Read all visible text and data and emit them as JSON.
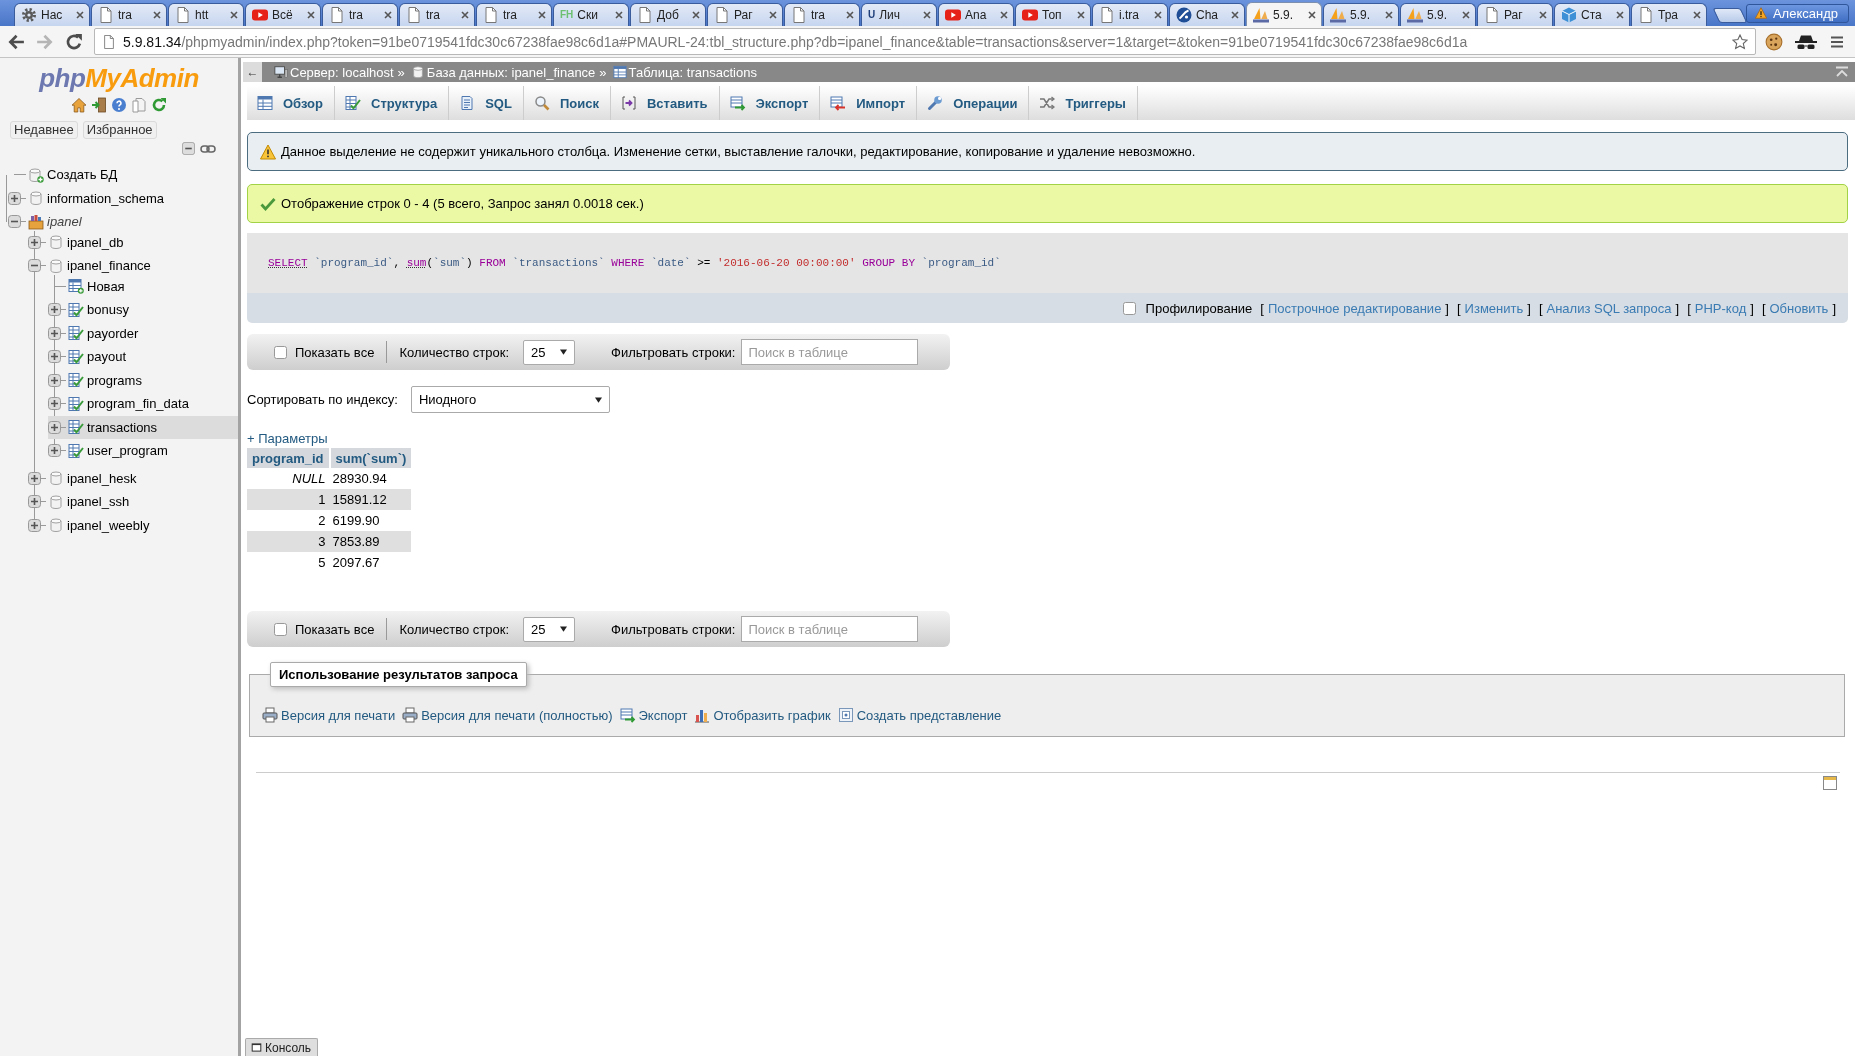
{
  "browser": {
    "tabs": [
      {
        "title": "Нас",
        "kind": "gear",
        "selected": false
      },
      {
        "title": "tra",
        "kind": "page",
        "selected": false
      },
      {
        "title": "htt",
        "kind": "page",
        "selected": false
      },
      {
        "title": "Всё",
        "kind": "video",
        "selected": false
      },
      {
        "title": "tra",
        "kind": "page",
        "selected": false
      },
      {
        "title": "tra",
        "kind": "page",
        "selected": false
      },
      {
        "title": "tra",
        "kind": "page",
        "selected": false
      },
      {
        "title": "Ски",
        "kind": "letters",
        "letters": "FH",
        "color": "#6cc070",
        "selected": false
      },
      {
        "title": "Доб",
        "kind": "page",
        "selected": false
      },
      {
        "title": "Раг",
        "kind": "page",
        "selected": false
      },
      {
        "title": "tra",
        "kind": "page",
        "selected": false
      },
      {
        "title": "Лич",
        "kind": "letters",
        "letters": "U",
        "color": "#1f3f7a",
        "selected": false
      },
      {
        "title": "Ana",
        "kind": "video",
        "selected": false
      },
      {
        "title": "Топ",
        "kind": "video",
        "selected": false
      },
      {
        "title": "i.tra",
        "kind": "page",
        "selected": false
      },
      {
        "title": "Cha",
        "kind": "circle-logo",
        "selected": false
      },
      {
        "title": "5.9.",
        "kind": "sail",
        "selected": true
      },
      {
        "title": "5.9.",
        "kind": "sail",
        "selected": false
      },
      {
        "title": "5.9.",
        "kind": "sail",
        "selected": false
      },
      {
        "title": "Раг",
        "kind": "page",
        "selected": false
      },
      {
        "title": "Ста",
        "kind": "cube",
        "selected": false
      },
      {
        "title": "Тра",
        "kind": "page",
        "selected": false
      }
    ],
    "profile": "Александр",
    "address": {
      "host": "5.9.81.34",
      "path": "/phpmyadmin/index.php?token=91be0719541fdc30c67238fae98c6d1a#PMAURL-24:tbl_structure.php?db=ipanel_finance&table=transactions&server=1&target=&token=91be0719541fdc30c67238fae98c6d1a"
    }
  },
  "sidebar": {
    "logo": {
      "prefix": "php",
      "name": "MyAdmin"
    },
    "buttons": [
      "Недавнее",
      "Избранное"
    ],
    "tree": [
      {
        "label": "Создать БД",
        "kind": "new-database",
        "selected": false
      },
      {
        "label": "information_schema",
        "kind": "database",
        "expanded": false,
        "selected": false
      },
      {
        "label": "ipanel",
        "kind": "group",
        "expanded": true,
        "selected": false,
        "children": [
          {
            "label": "ipanel_db",
            "kind": "database",
            "expanded": false,
            "selected": false
          },
          {
            "label": "ipanel_finance",
            "kind": "database",
            "expanded": true,
            "selected": false,
            "children": [
              {
                "label": "Новая",
                "kind": "new-table",
                "selected": false
              },
              {
                "label": "bonusy",
                "kind": "table",
                "expanded": false,
                "selected": false
              },
              {
                "label": "payorder",
                "kind": "table",
                "expanded": false,
                "selected": false
              },
              {
                "label": "payout",
                "kind": "table",
                "expanded": false,
                "selected": false
              },
              {
                "label": "programs",
                "kind": "table",
                "expanded": false,
                "selected": false
              },
              {
                "label": "program_fin_data",
                "kind": "table",
                "expanded": false,
                "selected": false
              },
              {
                "label": "transactions",
                "kind": "table",
                "expanded": false,
                "selected": true
              },
              {
                "label": "user_program",
                "kind": "table",
                "expanded": false,
                "selected": false
              }
            ]
          },
          {
            "label": "ipanel_hesk",
            "kind": "database",
            "expanded": false,
            "selected": false
          },
          {
            "label": "ipanel_ssh",
            "kind": "database",
            "expanded": false,
            "selected": false
          },
          {
            "label": "ipanel_weebly",
            "kind": "database",
            "expanded": false,
            "selected": false
          }
        ]
      }
    ]
  },
  "main": {
    "breadcrumb": {
      "back": "←",
      "items": [
        {
          "kind": "server",
          "label": "Сервер: localhost",
          "separator": "»"
        },
        {
          "kind": "database",
          "label": "База данных: ipanel_finance",
          "separator": "»"
        },
        {
          "kind": "table",
          "label": "Таблица: transactions"
        }
      ]
    },
    "menu": [
      {
        "label": "Обзор",
        "kind": "browse",
        "selected": false
      },
      {
        "label": "Структура",
        "kind": "structure",
        "selected": false
      },
      {
        "label": "SQL",
        "kind": "sql",
        "selected": false
      },
      {
        "label": "Поиск",
        "kind": "search",
        "selected": false
      },
      {
        "label": "Вставить",
        "kind": "insert",
        "selected": false
      },
      {
        "label": "Экспорт",
        "kind": "export",
        "selected": false
      },
      {
        "label": "Импорт",
        "kind": "import",
        "selected": false
      },
      {
        "label": "Операции",
        "kind": "operations",
        "selected": false
      },
      {
        "label": "Триггеры",
        "kind": "triggers",
        "selected": false
      }
    ],
    "warning": "Данное выделение не содержит уникального столбца. Изменение сетки, выставление галочки, редактирование, копирование и удаление невозможно.",
    "success": "Отображение строк 0 - 4 (5 всего, Запрос занял 0.0018 сек.)",
    "sql_query": [
      {
        "text": "SELECT",
        "kind": "keyword-link"
      },
      {
        "text": " `program_id`",
        "kind": "identifier"
      },
      {
        "text": ", ",
        "kind": "punct"
      },
      {
        "text": "sum",
        "kind": "function"
      },
      {
        "text": "(",
        "kind": "punct"
      },
      {
        "text": "`sum`",
        "kind": "identifier"
      },
      {
        "text": ") ",
        "kind": "punct"
      },
      {
        "text": "FROM",
        "kind": "keyword"
      },
      {
        "text": " `transactions` ",
        "kind": "identifier"
      },
      {
        "text": "WHERE",
        "kind": "keyword"
      },
      {
        "text": " `date` ",
        "kind": "identifier"
      },
      {
        "text": ">= ",
        "kind": "punct"
      },
      {
        "text": "'2016-06-20 00:00:00'",
        "kind": "string"
      },
      {
        "text": " GROUP BY",
        "kind": "keyword"
      },
      {
        "text": " `program_id`",
        "kind": "identifier"
      }
    ],
    "profiling": {
      "label": "Профилирование",
      "checked": false
    },
    "query_links": [
      {
        "open": "[",
        "label": "Построчное редактирование",
        "close": "]"
      },
      {
        "open": "[",
        "label": "Изменить",
        "close": "]"
      },
      {
        "open": "[",
        "label": "Анализ SQL запроса",
        "close": "]"
      },
      {
        "open": "[",
        "label": "PHP-код",
        "close": "]"
      },
      {
        "open": "[",
        "label": "Обновить",
        "close": "]"
      }
    ],
    "navigation_top": {
      "show_all": {
        "label": "Показать все",
        "checked": false
      },
      "rows_label": "Количество строк:",
      "rows_value": "25",
      "filter_label": "Фильтровать строки:",
      "filter_placeholder": "Поиск в таблице"
    },
    "sort": {
      "label": "Сортировать по индексу:",
      "value": "Ниодного"
    },
    "options_link": "+ Параметры",
    "table": {
      "columns": [
        "program_id",
        "sum(`sum`)"
      ],
      "rows": [
        {
          "cells": [
            {
              "text": "NULL",
              "null": true
            },
            {
              "text": "28930.94",
              "null": false
            }
          ]
        },
        {
          "cells": [
            {
              "text": "1",
              "null": false
            },
            {
              "text": "15891.12",
              "null": false
            }
          ]
        },
        {
          "cells": [
            {
              "text": "2",
              "null": false
            },
            {
              "text": "6199.90",
              "null": false
            }
          ]
        },
        {
          "cells": [
            {
              "text": "3",
              "null": false
            },
            {
              "text": "7853.89",
              "null": false
            }
          ]
        },
        {
          "cells": [
            {
              "text": "5",
              "null": false
            },
            {
              "text": "2097.67",
              "null": false
            }
          ]
        }
      ]
    },
    "navigation_bottom": {
      "show_all": {
        "label": "Показать все",
        "checked": false
      },
      "rows_label": "Количество строк:",
      "rows_value": "25",
      "filter_label": "Фильтровать строки:",
      "filter_placeholder": "Поиск в таблице"
    },
    "query_results": {
      "legend": "Использование результатов запроса",
      "links": [
        {
          "label": "Версия для печати",
          "kind": "print"
        },
        {
          "label": "Версия для печати (полностью)",
          "kind": "print"
        },
        {
          "label": "Экспорт",
          "kind": "export"
        },
        {
          "label": "Отобразить график",
          "kind": "chart"
        },
        {
          "label": "Создать представление",
          "kind": "view"
        }
      ]
    },
    "console": "Консоль"
  }
}
